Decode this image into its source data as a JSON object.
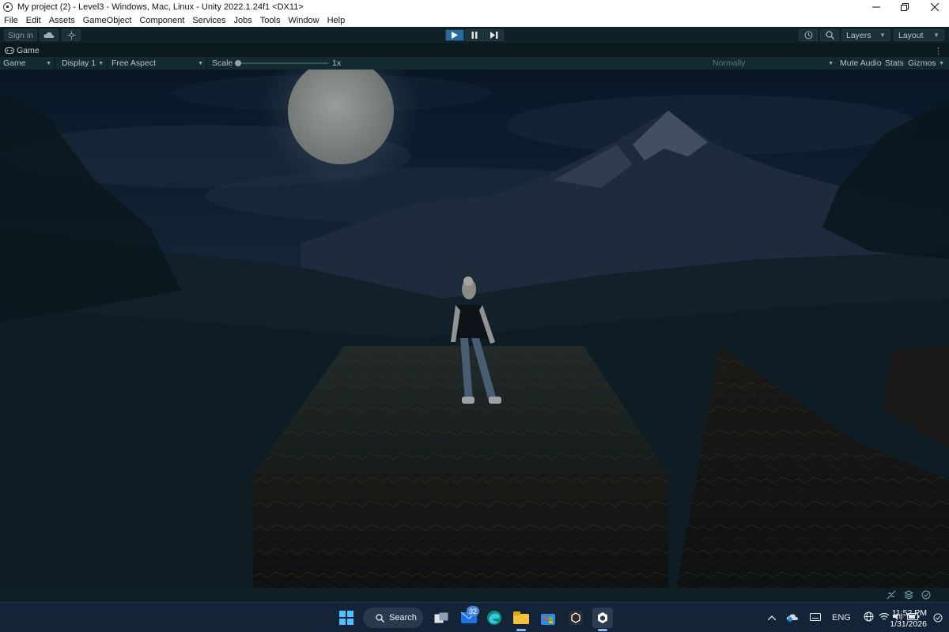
{
  "window": {
    "title": "My project (2) - Level3 - Windows, Mac, Linux - Unity 2022.1.24f1 <DX11>",
    "minimize_icon": "minimize-icon",
    "maximize_icon": "restore-icon",
    "close_icon": "close-icon"
  },
  "menu": {
    "items": [
      "File",
      "Edit",
      "Assets",
      "GameObject",
      "Component",
      "Services",
      "Jobs",
      "Tools",
      "Window",
      "Help"
    ]
  },
  "toolbar": {
    "signin_label": "Sign in",
    "cloud_icon": "cloud-icon",
    "collab_icon": "collab-icon",
    "play_icon": "play-icon",
    "pause_icon": "pause-icon",
    "step_icon": "step-icon",
    "history_icon": "history-icon",
    "search_icon": "search-icon",
    "layers_label": "Layers",
    "layout_label": "Layout",
    "play_active_color": "#2b6aa0"
  },
  "tab": {
    "icon": "gamepad-icon",
    "label": "Game",
    "more_icon": "more-options-icon"
  },
  "game_toolbar": {
    "view_select": "Game",
    "display_select": "Display 1",
    "aspect_select": "Free Aspect",
    "scale_label": "Scale",
    "scale_value": "1x",
    "play_mode": "Normally",
    "mute_audio": "Mute Audio",
    "stats": "Stats",
    "gizmos": "Gizmos"
  },
  "status_icons": [
    "network-icon",
    "layers-icon",
    "check-icon"
  ],
  "taskbar": {
    "search_label": "Search",
    "mail_badge": "32",
    "language": "ENG",
    "time": "11:52 PM",
    "date": "1/31/2026",
    "icons": [
      "windows-start-icon",
      "task-view-icon",
      "mail-icon",
      "edge-icon",
      "file-explorer-icon",
      "store-icon",
      "unity-hub-icon",
      "unity-editor-icon"
    ],
    "tray_icons": [
      "chevron-up-icon",
      "onedrive-icon",
      "keyboard-icon",
      "globe-icon",
      "wifi-icon",
      "volume-icon",
      "battery-icon"
    ]
  },
  "colors": {
    "editor_bg": "#0f2026",
    "taskbar_bg": "#142438",
    "accent": "#2b6aa0"
  }
}
